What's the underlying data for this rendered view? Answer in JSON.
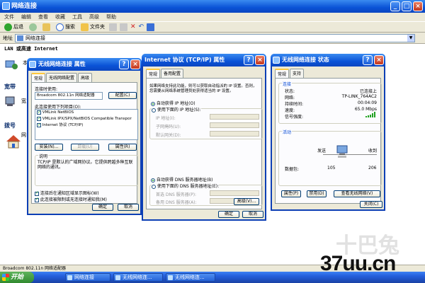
{
  "main": {
    "title": "网络连接",
    "menu": [
      "文件",
      "编辑",
      "查看",
      "收藏",
      "工具",
      "高级",
      "帮助"
    ],
    "toolbar": {
      "back": "后退",
      "search": "搜索",
      "folders": "文件夹"
    },
    "address_label": "地址",
    "address_value": "网络连接",
    "lan_header": "LAN 或高速 Internet",
    "left_labels": [
      "宽带",
      "拨号"
    ],
    "status": "Broadcom 802.11n 网络适配器"
  },
  "taskbar": {
    "start": "开始",
    "tasks": [
      "网络连接",
      "无线网络连...",
      "无线网络连..."
    ]
  },
  "dlg1": {
    "title": "无线网络连接 属性",
    "tabs": [
      "常规",
      "无线网络配置",
      "高级"
    ],
    "connect_using": "连接时使用:",
    "adapter": "Broadcom 802.11n 网络适配器",
    "configure": "配置(C)",
    "items_label": "此连接使用下列项目(O):",
    "items": [
      "VMLink NetBIOS",
      "VMLink IPX/SPX/NetBIOS Compatible Transpor",
      "Internet 协议 (TCP/IP)"
    ],
    "install": "安装(N)...",
    "uninstall": "卸载(U)",
    "properties": "属性(R)",
    "desc_label": "说明",
    "desc_text": [
      "TCP/IP 是默认的广域网协议。它提供跨越多种互联网络的通讯。"
    ],
    "chk1": "连接后在通知区域显示图标(W)",
    "chk2": "此连接被限制或无连接时通知我(M)",
    "ok": "确定",
    "cancel": "取消"
  },
  "dlg2": {
    "title": "Internet 协议 (TCP/IP) 属性",
    "tabs": [
      "常规",
      "备用配置"
    ],
    "intro": [
      "如果网络支持此功能，则可以获取自动指派的 IP 设置。否则，",
      "您需要从网络系统管理员处获得适当的 IP 设置。"
    ],
    "auto_ip": "自动获得 IP 地址(O)",
    "manual_ip": "使用下面的 IP 地址(S):",
    "ip_fields": [
      "IP 地址(I):",
      "子网掩码(U):",
      "默认网关(D):"
    ],
    "auto_dns": "自动获得 DNS 服务器地址(B)",
    "manual_dns": "使用下面的 DNS 服务器地址(E):",
    "dns_fields": [
      "首选 DNS 服务器(P):",
      "备用 DNS 服务器(A):"
    ],
    "advanced": "高级(V)...",
    "ok": "确定",
    "cancel": "取消"
  },
  "dlg3": {
    "title": "无线网络连接 状态",
    "tabs": [
      "常规",
      "支持"
    ],
    "conn_group": "连接",
    "rows": [
      {
        "label": "状态:",
        "value": "已连接上"
      },
      {
        "label": "网络:",
        "value": "TP-LINK_764AC2"
      },
      {
        "label": "持续时间:",
        "value": "00:04:09"
      },
      {
        "label": "速度:",
        "value": "65.0 Mbps"
      },
      {
        "label": "信号强度:",
        "value": ""
      }
    ],
    "activity_group": "活动",
    "sent": "发送",
    "received": "收到",
    "packets_label": "数据包:",
    "packets_sent": "105",
    "packets_recv": "206",
    "props": "属性(P)",
    "disable": "禁用(D)",
    "view_wireless": "查看无线网络(V)",
    "close": "关闭(C)"
  },
  "watermark": {
    "top": "十巴兔",
    "bottom": "37uu.cn"
  },
  "colors": {
    "titlebar": "#0a52d6",
    "dialog_bg": "#ece9d8",
    "accent_green": "#21a121"
  }
}
